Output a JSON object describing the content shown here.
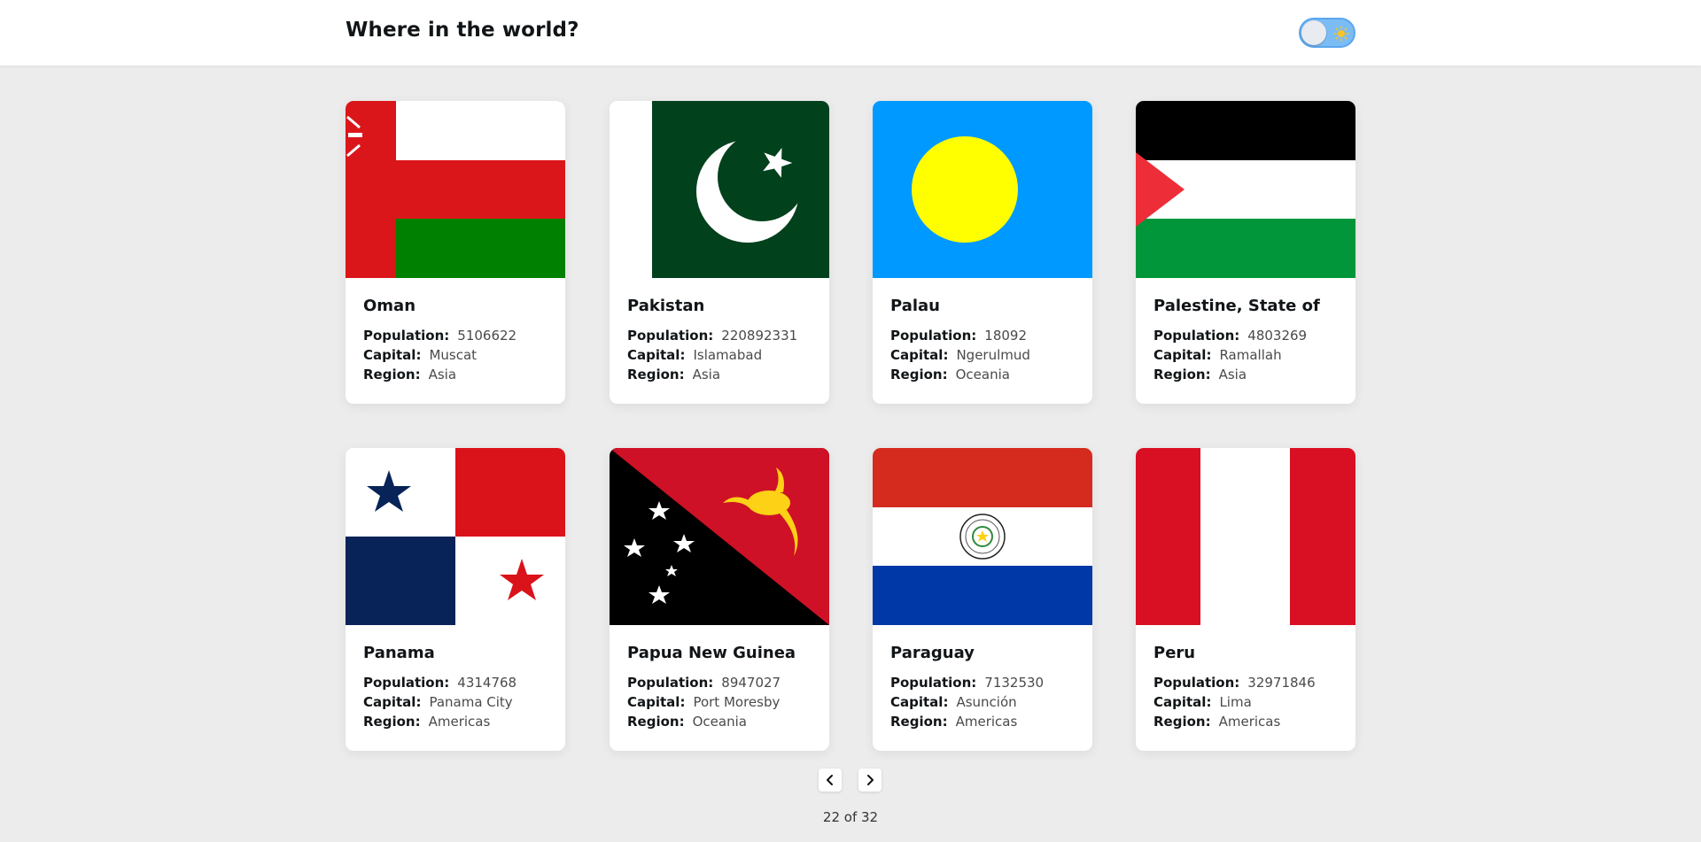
{
  "header": {
    "title": "Where in the world?",
    "theme_toggle_icon": "sun-icon"
  },
  "labels": {
    "population": "Population:",
    "capital": "Capital:",
    "region": "Region:"
  },
  "countries": [
    {
      "name": "Oman",
      "population": "5106622",
      "capital": "Muscat",
      "region": "Asia",
      "flag_icon": "oman-flag"
    },
    {
      "name": "Pakistan",
      "population": "220892331",
      "capital": "Islamabad",
      "region": "Asia",
      "flag_icon": "pakistan-flag"
    },
    {
      "name": "Palau",
      "population": "18092",
      "capital": "Ngerulmud",
      "region": "Oceania",
      "flag_icon": "palau-flag"
    },
    {
      "name": "Palestine, State of",
      "population": "4803269",
      "capital": "Ramallah",
      "region": "Asia",
      "flag_icon": "palestine-flag"
    },
    {
      "name": "Panama",
      "population": "4314768",
      "capital": "Panama City",
      "region": "Americas",
      "flag_icon": "panama-flag"
    },
    {
      "name": "Papua New Guinea",
      "population": "8947027",
      "capital": "Port Moresby",
      "region": "Oceania",
      "flag_icon": "papua-new-guinea-flag"
    },
    {
      "name": "Paraguay",
      "population": "7132530",
      "capital": "Asunción",
      "region": "Americas",
      "flag_icon": "paraguay-flag"
    },
    {
      "name": "Peru",
      "population": "32971846",
      "capital": "Lima",
      "region": "Americas",
      "flag_icon": "peru-flag"
    }
  ],
  "pagination": {
    "prev_icon": "chevron-left-icon",
    "next_icon": "chevron-right-icon",
    "status": "22 of 32"
  },
  "colors": {
    "background": "#ececec",
    "card": "#ffffff",
    "text": "#111517",
    "toggle": "#7cbcf5"
  }
}
